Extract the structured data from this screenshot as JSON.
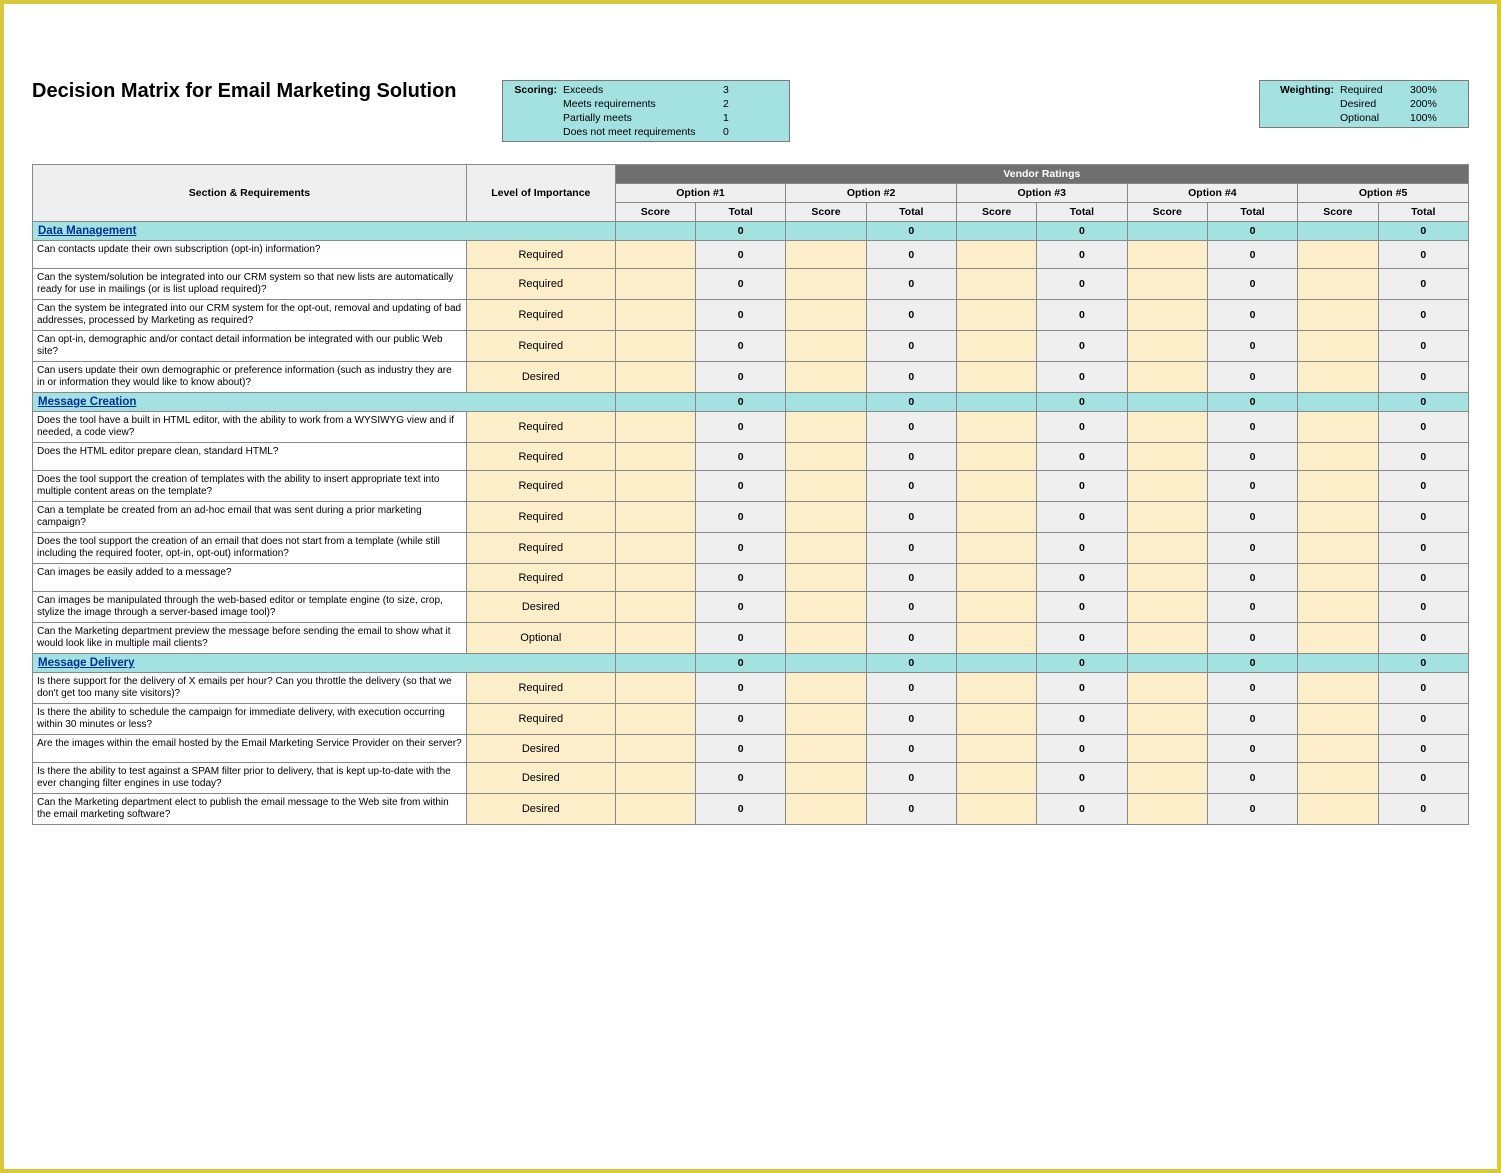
{
  "title": "Decision Matrix for Email Marketing Solution",
  "scoring": {
    "label": "Scoring:",
    "rows": [
      {
        "desc": "Exceeds",
        "val": "3"
      },
      {
        "desc": "Meets requirements",
        "val": "2"
      },
      {
        "desc": "Partially meets",
        "val": "1"
      },
      {
        "desc": "Does not meet requirements",
        "val": "0"
      }
    ]
  },
  "weighting": {
    "label": "Weighting:",
    "rows": [
      {
        "desc": "Required",
        "val": "300%"
      },
      {
        "desc": "Desired",
        "val": "200%"
      },
      {
        "desc": "Optional",
        "val": "100%"
      }
    ]
  },
  "headers": {
    "sectionReq": "Section & Requirements",
    "loi": "Level of Importance",
    "vendorRatings": "Vendor Ratings",
    "options": [
      "Option #1",
      "Option #2",
      "Option #3",
      "Option #4",
      "Option #5"
    ],
    "score": "Score",
    "total": "Total"
  },
  "sections": [
    {
      "name": "Data Management",
      "totals": [
        "0",
        "0",
        "0",
        "0",
        "0"
      ],
      "rows": [
        {
          "text": "Can contacts update their own subscription (opt-in) information?",
          "loi": "Required",
          "totals": [
            "0",
            "0",
            "0",
            "0",
            "0"
          ]
        },
        {
          "text": "Can the system/solution be integrated into our CRM system so that new lists are automatically ready for use in mailings (or is list upload required)?",
          "loi": "Required",
          "totals": [
            "0",
            "0",
            "0",
            "0",
            "0"
          ]
        },
        {
          "text": "Can the system be integrated into our CRM system for the opt-out, removal and updating of bad addresses, processed by Marketing as required?",
          "loi": "Required",
          "totals": [
            "0",
            "0",
            "0",
            "0",
            "0"
          ]
        },
        {
          "text": "Can opt-in, demographic and/or contact detail information be integrated with our public Web site?",
          "loi": "Required",
          "totals": [
            "0",
            "0",
            "0",
            "0",
            "0"
          ]
        },
        {
          "text": "Can users update their own demographic or preference information (such as industry they are in or information they would like to know about)?",
          "loi": "Desired",
          "totals": [
            "0",
            "0",
            "0",
            "0",
            "0"
          ]
        }
      ]
    },
    {
      "name": "Message Creation",
      "totals": [
        "0",
        "0",
        "0",
        "0",
        "0"
      ],
      "rows": [
        {
          "text": "Does the tool have a built in HTML editor, with the ability to work from a WYSIWYG view and if needed, a code view?",
          "loi": "Required",
          "totals": [
            "0",
            "0",
            "0",
            "0",
            "0"
          ]
        },
        {
          "text": "Does the HTML editor prepare clean, standard HTML?",
          "loi": "Required",
          "totals": [
            "0",
            "0",
            "0",
            "0",
            "0"
          ]
        },
        {
          "text": "Does the tool support the creation of templates with the ability to insert appropriate text into multiple content areas on the template?",
          "loi": "Required",
          "totals": [
            "0",
            "0",
            "0",
            "0",
            "0"
          ]
        },
        {
          "text": "Can a template be created from an ad-hoc email that was sent during a prior marketing campaign?",
          "loi": "Required",
          "totals": [
            "0",
            "0",
            "0",
            "0",
            "0"
          ]
        },
        {
          "text": "Does the tool support the creation of an email that does not start from a template (while still including the required footer, opt-in, opt-out) information?",
          "loi": "Required",
          "totals": [
            "0",
            "0",
            "0",
            "0",
            "0"
          ]
        },
        {
          "text": "Can images be easily added to a message?",
          "loi": "Required",
          "totals": [
            "0",
            "0",
            "0",
            "0",
            "0"
          ]
        },
        {
          "text": "Can images be manipulated through the web-based editor or template engine (to size, crop, stylize the image through a server-based image tool)?",
          "loi": "Desired",
          "totals": [
            "0",
            "0",
            "0",
            "0",
            "0"
          ]
        },
        {
          "text": "Can the Marketing department preview the message before sending the email to show what it would look like in multiple mail clients?",
          "loi": "Optional",
          "totals": [
            "0",
            "0",
            "0",
            "0",
            "0"
          ]
        }
      ]
    },
    {
      "name": "Message Delivery",
      "totals": [
        "0",
        "0",
        "0",
        "0",
        "0"
      ],
      "rows": [
        {
          "text": "Is there support for the delivery of X emails per hour?  Can you throttle the delivery (so that we don't get too many site visitors)?",
          "loi": "Required",
          "totals": [
            "0",
            "0",
            "0",
            "0",
            "0"
          ]
        },
        {
          "text": "Is there the ability to schedule the campaign for immediate delivery, with execution occurring within 30 minutes or less?",
          "loi": "Required",
          "totals": [
            "0",
            "0",
            "0",
            "0",
            "0"
          ]
        },
        {
          "text": "Are the images within the email hosted by the Email Marketing Service Provider on their server?",
          "loi": "Desired",
          "totals": [
            "0",
            "0",
            "0",
            "0",
            "0"
          ]
        },
        {
          "text": "Is there the ability to test against a SPAM filter prior to delivery, that is kept up-to-date with the ever changing filter engines in use today?",
          "loi": "Desired",
          "totals": [
            "0",
            "0",
            "0",
            "0",
            "0"
          ]
        },
        {
          "text": "Can the Marketing department elect to publish the email message to the Web site from within the email marketing software?",
          "loi": "Desired",
          "totals": [
            "0",
            "0",
            "0",
            "0",
            "0"
          ]
        }
      ]
    }
  ]
}
